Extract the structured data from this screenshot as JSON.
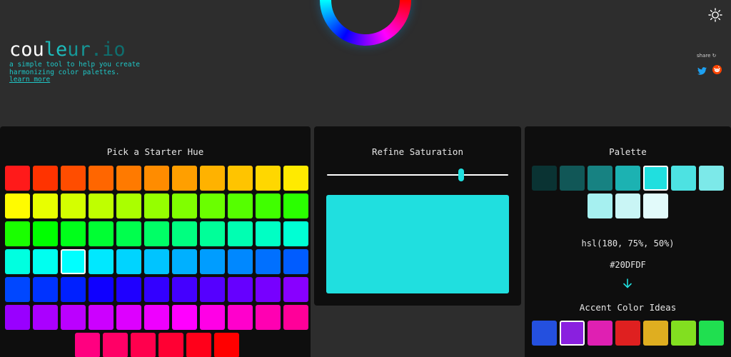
{
  "header": {
    "logo": {
      "part1": "cou",
      "part2": "le",
      "part3": "ur",
      "part4": ".io"
    },
    "tagline": "a simple tool to help you create harmonizing color palettes.",
    "learn_more": "learn more",
    "share_label": "share",
    "icons": {
      "theme": "sun-icon",
      "twitter": "twitter-icon",
      "reddit": "reddit-icon",
      "hue_ring": "hue-ring"
    }
  },
  "hue_panel": {
    "title": "Pick a Starter Hue",
    "selected_index": 35,
    "colors": [
      "#ff1a1a",
      "#ff3300",
      "#ff4d00",
      "#ff6600",
      "#ff7a00",
      "#ff8c00",
      "#ff9f00",
      "#ffb200",
      "#ffc400",
      "#ffd700",
      "#ffea00",
      "#fffb00",
      "#e8ff00",
      "#d4ff00",
      "#bfff00",
      "#aaff00",
      "#95ff00",
      "#80ff00",
      "#6aff00",
      "#55ff00",
      "#40ff00",
      "#2aff00",
      "#1aff00",
      "#00ff00",
      "#00ff1a",
      "#00ff33",
      "#00ff4d",
      "#00ff66",
      "#00ff80",
      "#00ff99",
      "#00ffb2",
      "#00ffc4",
      "#00ffd4",
      "#00ffe0",
      "#00fff0",
      "#00ffff",
      "#00e8ff",
      "#00d4ff",
      "#00c4ff",
      "#00b0ff",
      "#009dff",
      "#0088ff",
      "#0070ff",
      "#005cff",
      "#0047ff",
      "#0033ff",
      "#0020ff",
      "#0f00ff",
      "#1f00ff",
      "#3300ff",
      "#4400ff",
      "#5500ff",
      "#6600ff",
      "#7700ff",
      "#8800ff",
      "#9900ff",
      "#aa00ff",
      "#bb00ff",
      "#cc00ff",
      "#dd00ff",
      "#ee00ff",
      "#ff00ff",
      "#ff00e6",
      "#ff00cc",
      "#ff00b2",
      "#ff0099",
      "#ff0080",
      "#ff0066",
      "#ff004d",
      "#ff0033",
      "#ff001a",
      "#ff0000"
    ]
  },
  "saturation_panel": {
    "title": "Refine Saturation",
    "saturation_value": 75,
    "preview_color": "#20dfdf"
  },
  "palette_panel": {
    "title": "Palette",
    "selected_index": 4,
    "colors": [
      "#0a3333",
      "#115757",
      "#178282",
      "#1cb2b2",
      "#20dfdf",
      "#4de2e2",
      "#7ce9e9",
      "#a6f0f0",
      "#c9f5f5",
      "#e2fafa"
    ],
    "hsl_text": "hsl(180, 75%, 50%)",
    "hex_text": "#20DFDF",
    "arrow_icon": "arrow-down-icon",
    "accent_title": "Accent Color Ideas",
    "accent_selected_index": 1,
    "accents": [
      "#2450df",
      "#8a20df",
      "#df20b2",
      "#df2020",
      "#dfae20",
      "#82df20",
      "#20df50"
    ]
  }
}
